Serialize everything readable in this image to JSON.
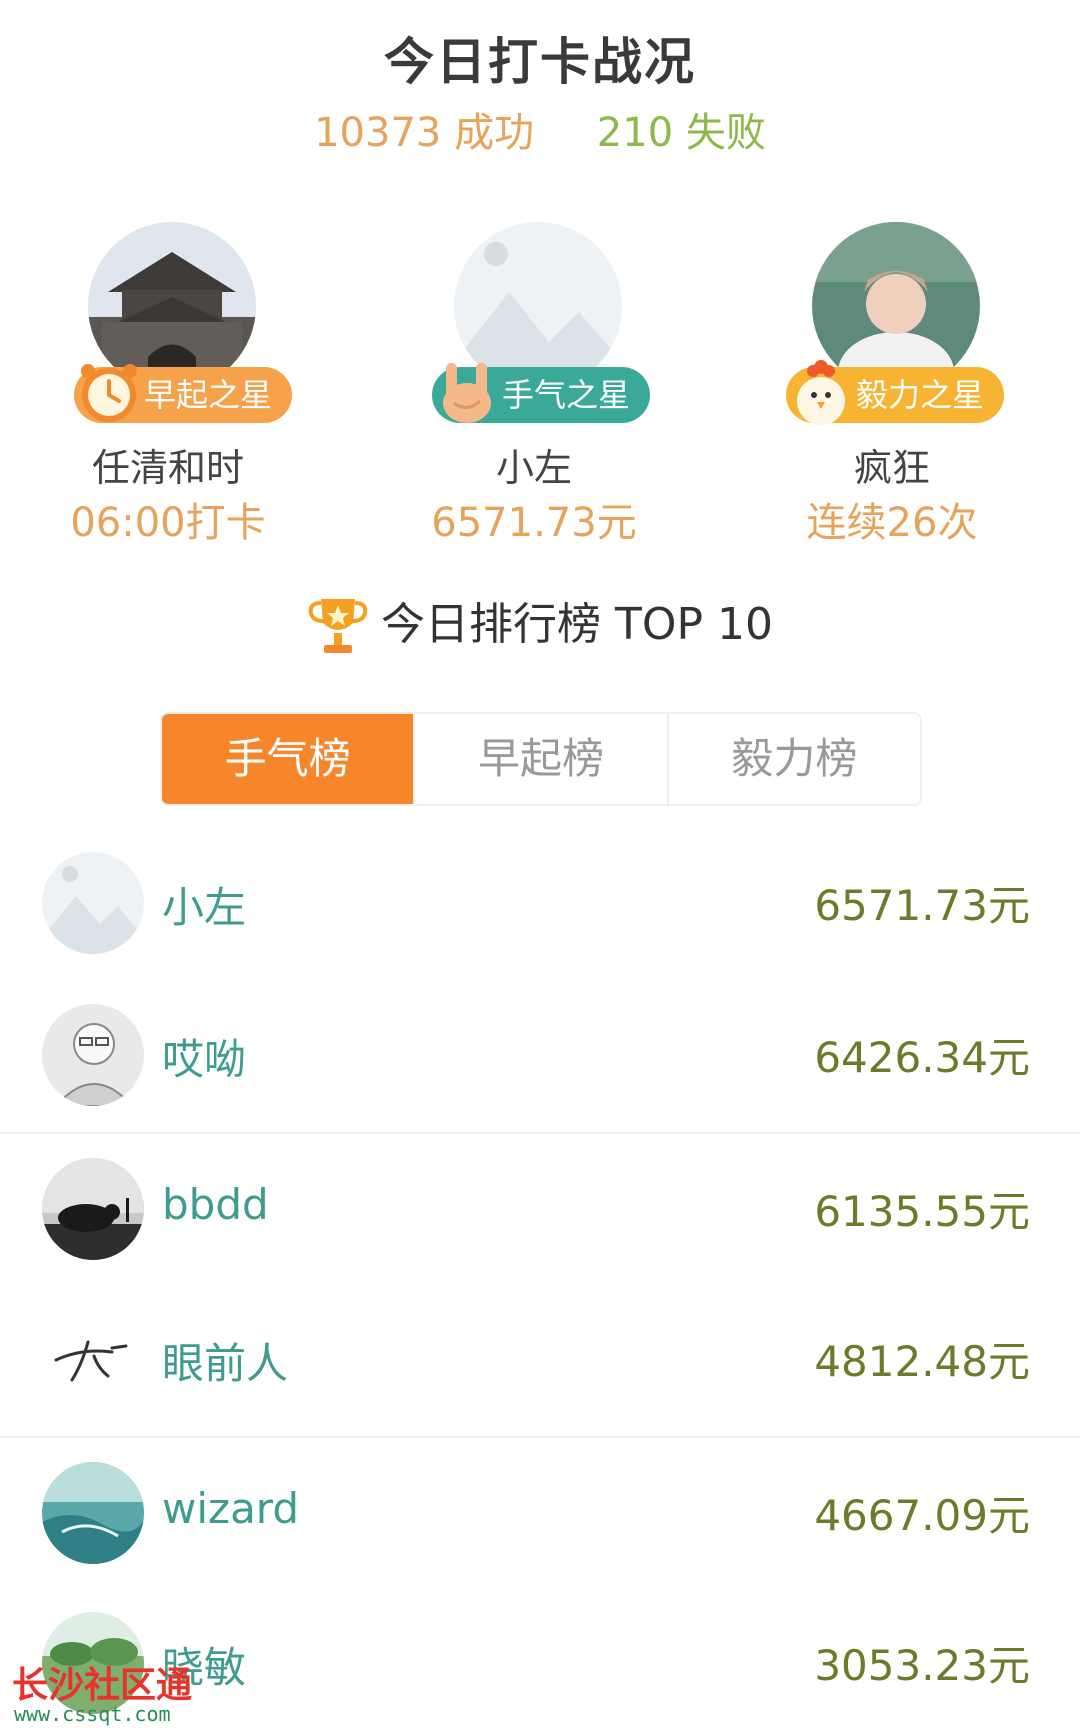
{
  "header": {
    "title": "今日打卡战况",
    "success_count": "10373",
    "success_label": "成功",
    "fail_count": "210",
    "fail_label": "失败"
  },
  "stars": [
    {
      "badge": "早起之星",
      "name": "任清和时",
      "stat": "06:00打卡",
      "badge_color": "#f5a24a"
    },
    {
      "badge": "手气之星",
      "name": "小左",
      "stat": "6571.73元",
      "badge_color": "#3aa99a"
    },
    {
      "badge": "毅力之星",
      "name": "疯狂",
      "stat": "连续26次",
      "badge_color": "#f6b432"
    }
  ],
  "ranking": {
    "title": "今日排行榜 TOP 10",
    "tabs": [
      "手气榜",
      "早起榜",
      "毅力榜"
    ],
    "active_tab": "手气榜",
    "rows": [
      {
        "name": "小左",
        "amount": "6571.73元"
      },
      {
        "name": "哎呦",
        "amount": "6426.34元"
      },
      {
        "name": "bbdd",
        "amount": "6135.55元"
      },
      {
        "name": "眼前人",
        "amount": "4812.48元"
      },
      {
        "name": "wizard",
        "amount": "4667.09元"
      },
      {
        "name": "晓敏",
        "amount": "3053.23元"
      }
    ]
  },
  "watermark": {
    "text": "长沙社区通",
    "url": "www.cssqt.com"
  }
}
